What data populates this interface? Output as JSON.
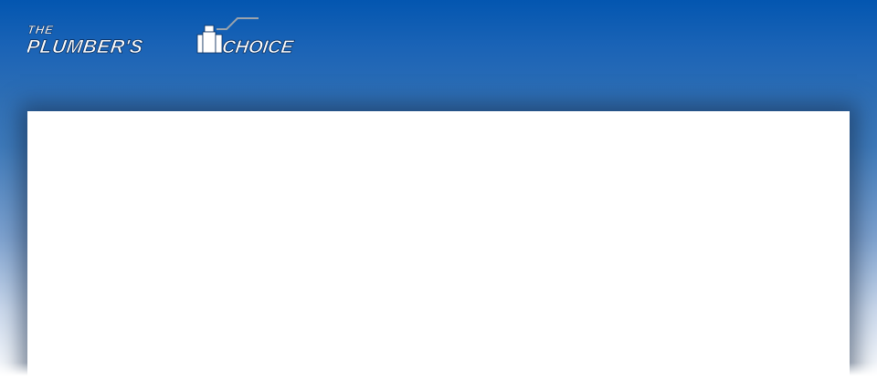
{
  "header": {
    "logo": {
      "line1": "THE",
      "line2": "PLUMBER'S",
      "line3": "CHOICE",
      "icon": "ball-valve-icon"
    }
  },
  "colors": {
    "header_blue": "#0356b0",
    "logo_text": "#ffffff",
    "logo_outline": "#0b2e5c",
    "panel": "#ffffff"
  },
  "main": {
    "content": ""
  }
}
